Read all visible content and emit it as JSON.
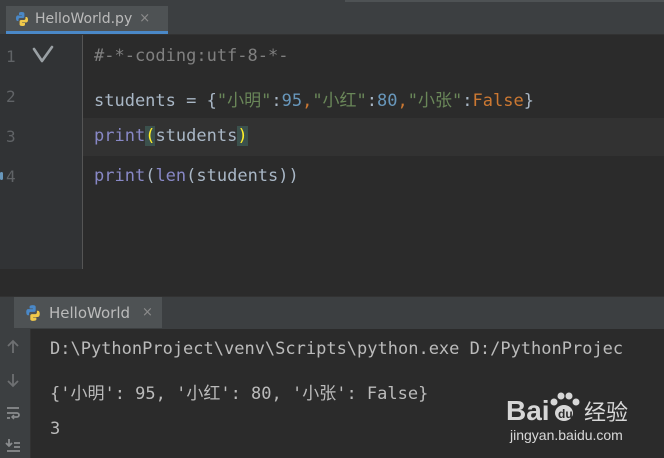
{
  "editor_tab": {
    "filename": "HelloWorld.py",
    "close": "×",
    "icon": "python-file-icon"
  },
  "gutter": {
    "line_numbers": [
      "1",
      "2",
      "3",
      "4"
    ],
    "check_icon": "checkmark-icon"
  },
  "code": {
    "line1": {
      "comment": "#-*-coding:utf-8-*-"
    },
    "line2": {
      "var": "students = ",
      "open": "{",
      "k1": "\"小明\"",
      "c1": ":",
      "v1": "95",
      "s1": ",",
      "k2": "\"小红\"",
      "c2": ":",
      "v2": "80",
      "s2": ",",
      "k3": "\"小张\"",
      "c3": ":",
      "v3": "False",
      "close": "}"
    },
    "line3": {
      "fn": "print",
      "open": "(",
      "arg": "students",
      "close": ")"
    },
    "line4": {
      "fn": "print",
      "open": "(",
      "fn2": "len",
      "rest": "(students))"
    }
  },
  "run_panel": {
    "tab_label": "HelloWorld",
    "close": "×",
    "icon": "python-run-icon"
  },
  "tool_buttons": [
    "arrow-up-icon",
    "arrow-down-icon",
    "soft-wrap-icon",
    "scroll-to-end-icon"
  ],
  "console": {
    "command": "D:\\PythonProject\\venv\\Scripts\\python.exe D:/PythonProjec",
    "dict_output": "{'小明': 95, '小红': 80, '小张': False}",
    "len_output": "3"
  },
  "watermark": {
    "brand_left": "Bai",
    "brand_right": "du",
    "cn": "经验",
    "url": "jingyan.baidu.com"
  },
  "colors": {
    "background": "#2b2b2b",
    "comment": "#808080",
    "string": "#6a8759",
    "number": "#6897bb",
    "keyword": "#cc7832",
    "builtin": "#8888c6",
    "brace_highlight": "#ffef28"
  }
}
